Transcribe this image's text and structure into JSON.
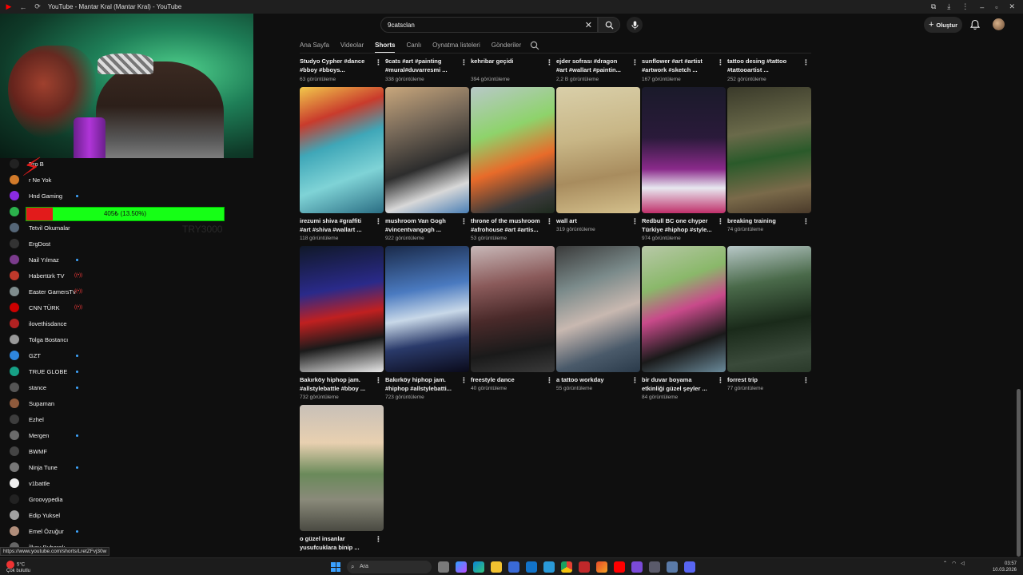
{
  "window": {
    "tab_title": "YouTube - Mantar Kral (Mantar Kral) - YouTube"
  },
  "header": {
    "search_value": "9catsclan",
    "create_label": "Oluştur"
  },
  "channel_tabs": [
    {
      "label": "Ana Sayfa",
      "active": false
    },
    {
      "label": "Videolar",
      "active": false
    },
    {
      "label": "Shorts",
      "active": true
    },
    {
      "label": "Canlı",
      "active": false
    },
    {
      "label": "Oynatma listeleri",
      "active": false
    },
    {
      "label": "Gönderiler",
      "active": false
    }
  ],
  "overlay": {
    "goal_label": "405₺ (13.50%)",
    "goal_fraction": 0.135,
    "goal_caption": "TRY3000"
  },
  "subscriptions": [
    {
      "name": "Pro B",
      "color": "#222222",
      "live": false,
      "dot": false
    },
    {
      "name": "r Ne Yok",
      "color": "#d17a2a",
      "live": false,
      "dot": false
    },
    {
      "name": "Hnd Gaming",
      "color": "#8a2be2",
      "live": false,
      "dot": true
    },
    {
      "name": "",
      "color": "#2bb24c",
      "live": false,
      "dot": false
    },
    {
      "name": "Tetvil Okumalar",
      "color": "#556677",
      "live": false,
      "dot": false
    },
    {
      "name": "ErgDost",
      "color": "#333333",
      "live": false,
      "dot": false
    },
    {
      "name": "Nail Yılmaz",
      "color": "#7a3b8c",
      "live": false,
      "dot": true
    },
    {
      "name": "Habertürk TV",
      "color": "#c0392b",
      "live": true,
      "dot": false
    },
    {
      "name": "Easter GamersTv",
      "color": "#7f8c8d",
      "live": true,
      "dot": false
    },
    {
      "name": "CNN TÜRK",
      "color": "#cc0000",
      "live": true,
      "dot": false
    },
    {
      "name": "ilovethisdance",
      "color": "#b22222",
      "live": false,
      "dot": false
    },
    {
      "name": "Tolga Bostancı",
      "color": "#999999",
      "live": false,
      "dot": false
    },
    {
      "name": "GZT",
      "color": "#2e86de",
      "live": false,
      "dot": true
    },
    {
      "name": "TRUE GLOBE",
      "color": "#16a085",
      "live": false,
      "dot": true
    },
    {
      "name": "stance",
      "color": "#555555",
      "live": false,
      "dot": true
    },
    {
      "name": "Supaman",
      "color": "#8e5a3c",
      "live": false,
      "dot": false
    },
    {
      "name": "Ezhel",
      "color": "#3d3d3d",
      "live": false,
      "dot": false
    },
    {
      "name": "Mergen",
      "color": "#6b6b6b",
      "live": false,
      "dot": true
    },
    {
      "name": "BWMF",
      "color": "#444444",
      "live": false,
      "dot": false
    },
    {
      "name": "Ninja Tune",
      "color": "#777777",
      "live": false,
      "dot": true
    },
    {
      "name": "v1battle",
      "color": "#eeeeee",
      "live": false,
      "dot": false
    },
    {
      "name": "Groovypedia",
      "color": "#222222",
      "live": false,
      "dot": false
    },
    {
      "name": "Edip Yuksel",
      "color": "#a0a0a0",
      "live": false,
      "dot": false
    },
    {
      "name": "Emel Özuğur",
      "color": "#b08d7a",
      "live": false,
      "dot": true
    },
    {
      "name": "İlkay Buharalı",
      "color": "#666666",
      "live": false,
      "dot": false
    }
  ],
  "shorts_top_row": [
    {
      "title": "Studyo Cypher #dance #bboy #bboys...",
      "views": "63 görüntüleme"
    },
    {
      "title": "9cats #art #painting #mural#duvarresmi ...",
      "views": "338 görüntüleme"
    },
    {
      "title": "kehribar geçidi",
      "views": "394 görüntüleme"
    },
    {
      "title": "ejder sofrası #dragon #art #wallart #paintin...",
      "views": "2,2 B görüntüleme"
    },
    {
      "title": "sunflower  #art #artist #artwork #sketch ...",
      "views": "167 görüntüleme"
    },
    {
      "title": "tattoo desing #tattoo #tattooartist ...",
      "views": "252 görüntüleme"
    }
  ],
  "shorts": [
    {
      "title": "irezumi shiva #graffiti #art #shiva #wallart ...",
      "views": "118 görüntüleme",
      "thumb": "linear-gradient(160deg,#f2c84b 0%,#c93b2c 25%,#3fa7b8 45%,#7fd3d6 70%,#2a6d83 100%)"
    },
    {
      "title": "mushroom Van Gogh #vincentvangogh ...",
      "views": "922 görüntüleme",
      "thumb": "linear-gradient(160deg,#c9a77c 0%,#7a6b5a 30%,#2d2d2d 60%,#d8d8d8 80%,#4a7fb5 100%)"
    },
    {
      "title": "throne of the mushroom #afrohouse #art #artis...",
      "views": "53 görüntüleme",
      "thumb": "linear-gradient(160deg,#b8c8c8 0%,#8ed36b 35%,#e86b2a 60%,#3a3a3a 85%,#1d2a1d 100%)"
    },
    {
      "title": "wall art",
      "views": "319 görüntüleme",
      "thumb": "linear-gradient(170deg,#d9cfa9 0%,#c8b686 40%,#a88c5e 70%,#d4c08c 100%)"
    },
    {
      "title": "Redbull BC one chyper Türkiye #hiphop #style...",
      "views": "974 görüntüleme",
      "thumb": "linear-gradient(180deg,#1a1a2a 0%,#2a1a3a 40%,#8a2a8a 65%,#e8e8f0 80%,#c0306a 100%)"
    },
    {
      "title": "breaking training",
      "views": "74 görüntüleme",
      "thumb": "linear-gradient(170deg,#3a3a2a 0%,#6a6a4a 35%,#2a5a2a 55%,#7a6a4a 80%,#4a3a2a 100%)"
    },
    {
      "title": "Bakırköy hiphop jam. #allstylebattle #bboy ...",
      "views": "732 görüntüleme",
      "thumb": "linear-gradient(170deg,#101828 0%,#2a2a8a 35%,#c02020 55%,#1a1a1a 75%,#e8e8e8 100%)"
    },
    {
      "title": "Bakırköy hiphop jam. #hiphop #allstylebatti...",
      "views": "723 görüntüleme",
      "thumb": "linear-gradient(170deg,#1a2a4a 0%,#4a7ac0 35%,#c8d8e8 55%,#2a3a6a 75%,#0a0a1a 100%)"
    },
    {
      "title": "freestyle dance",
      "views": "40 görüntüleme",
      "thumb": "linear-gradient(170deg,#c8b8b8 0%,#8a5a5a 30%,#4a2a2a 55%,#1a1a1a 80%,#3a3a3a 100%)"
    },
    {
      "title": "a tattoo workday",
      "views": "55 görüntüleme",
      "thumb": "linear-gradient(160deg,#3a3a3a 0%,#7a8a8a 30%,#c8b8b0 55%,#4a5a6a 80%,#2a3a4a 100%)"
    },
    {
      "title": "bir duvar boyama etkinliği güzel şeyler ...",
      "views": "84 görüntüleme",
      "thumb": "linear-gradient(160deg,#b8c8a8 0%,#8ab86a 30%,#c84a8a 50%,#1a1a1a 75%,#6a8a9a 100%)"
    },
    {
      "title": "forrest trip",
      "views": "77 görüntüleme",
      "thumb": "linear-gradient(170deg,#b8c8c8 0%,#4a6a4a 30%,#1a2a1a 60%,#3a4a3a 85%,#2a3a2a 100%)"
    },
    {
      "title": "o güzel insanlar yusufcuklara binip ...",
      "views": "",
      "thumb": "linear-gradient(180deg,#c8c0b8 0%,#e8d0b0 30%,#6a8a5a 55%,#8a8a7a 75%,#4a4a42 100%)"
    }
  ],
  "status_url": "https://www.youtube.com/shorts/LretZFvj30w",
  "taskbar": {
    "weather_temp": "5°C",
    "weather_desc": "Çok bulutlu",
    "search_label": "Ara",
    "time": "03:57",
    "date": "10.03.2026"
  }
}
